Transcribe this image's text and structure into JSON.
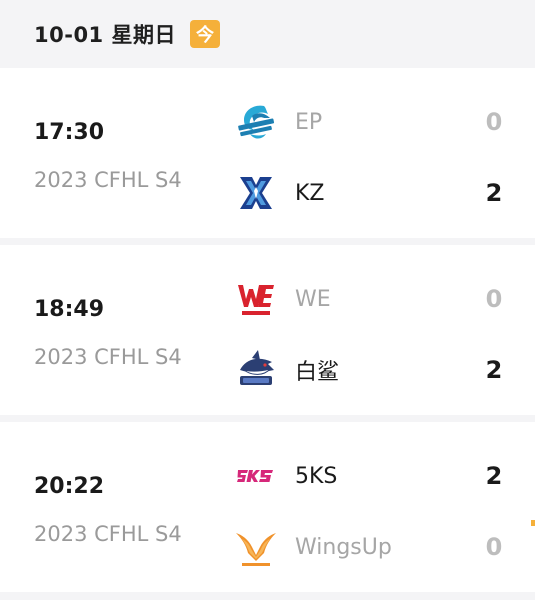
{
  "header": {
    "date": "10-01 星期日",
    "today_badge": "今"
  },
  "colors": {
    "accent": "#f5b03a",
    "winner_text": "#1a1a1a",
    "loser_text": "#a6a6a6",
    "muted_text": "#9a9a9a"
  },
  "matches": [
    {
      "time": "17:30",
      "league": "2023 CFHL S4",
      "team1": {
        "name": "EP",
        "score": "0",
        "logo": "evolution-power-dragon-logo",
        "result": "loser"
      },
      "team2": {
        "name": "KZ",
        "score": "2",
        "logo": "kz-blue-x-logo",
        "result": "winner"
      }
    },
    {
      "time": "18:49",
      "league": "2023 CFHL S4",
      "team1": {
        "name": "WE",
        "score": "0",
        "logo": "team-we-red-logo",
        "result": "loser"
      },
      "team2": {
        "name": "白鲨",
        "score": "2",
        "logo": "white-shark-logo",
        "result": "winner"
      }
    },
    {
      "time": "20:22",
      "league": "2023 CFHL S4",
      "team1": {
        "name": "5KS",
        "score": "2",
        "logo": "5ks-pink-logo",
        "result": "winner"
      },
      "team2": {
        "name": "WingsUp",
        "score": "0",
        "logo": "wings-up-orange-logo",
        "result": "loser"
      }
    }
  ]
}
